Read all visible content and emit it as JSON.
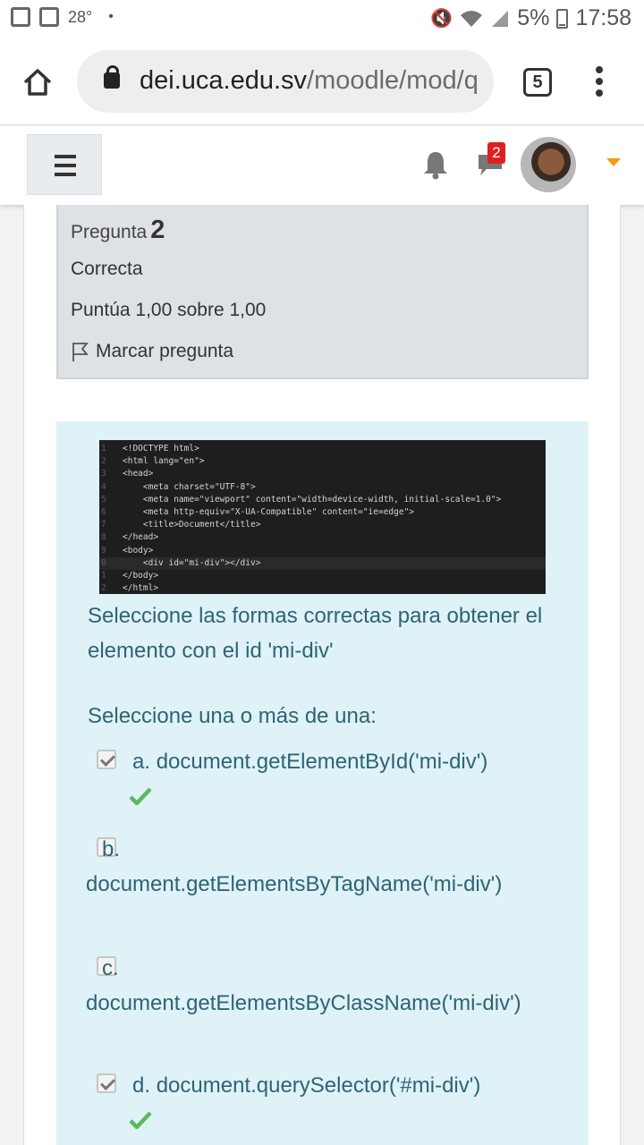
{
  "status_bar": {
    "temperature": "28°",
    "dot": "•",
    "battery": "5%",
    "time": "17:58"
  },
  "browser": {
    "url_domain": "dei.uca.edu.sv",
    "url_path": "/moodle/mod/q",
    "tab_count": "5"
  },
  "navbar": {
    "notification_badge": "2",
    "accent_color": "#f39c12"
  },
  "question_info": {
    "label": "Pregunta",
    "number": "2",
    "state": "Correcta",
    "grade": "Puntúa 1,00 sobre 1,00",
    "flag": "Marcar pregunta"
  },
  "code_snippet": {
    "lines": [
      {
        "no": "1",
        "text": "<!DOCTYPE html>"
      },
      {
        "no": "2",
        "text": "<html lang=\"en\">"
      },
      {
        "no": "3",
        "text": "<head>"
      },
      {
        "no": "4",
        "text": "    <meta charset=\"UTF-8\">"
      },
      {
        "no": "5",
        "text": "    <meta name=\"viewport\" content=\"width=device-width, initial-scale=1.0\">"
      },
      {
        "no": "6",
        "text": "    <meta http-equiv=\"X-UA-Compatible\" content=\"ie=edge\">"
      },
      {
        "no": "7",
        "text": "    <title>Document</title>"
      },
      {
        "no": "8",
        "text": "</head>"
      },
      {
        "no": "9",
        "text": "<body>"
      },
      {
        "no": "0",
        "text": "    <div id=\"mi-div\"></div>"
      },
      {
        "no": "1",
        "text": "</body>"
      },
      {
        "no": "2",
        "text": "</html>"
      }
    ]
  },
  "question": {
    "text": "Seleccione las formas correctas para obtener el elemento con el id 'mi-div'",
    "prompt": "Seleccione una o más de una:",
    "options": [
      {
        "letter": "a.",
        "text": "document.getElementById('mi-div')",
        "checked": true,
        "correct": true
      },
      {
        "letter": "b.",
        "text": "document.getElementsByTagName('mi-div')",
        "checked": false,
        "correct": false
      },
      {
        "letter": "c.",
        "text": "document.getElementsByClassName('mi-div')",
        "checked": false,
        "correct": false
      },
      {
        "letter": "d.",
        "text": "document.querySelector('#mi-div')",
        "checked": true,
        "correct": true
      }
    ]
  },
  "colors": {
    "correct_tick": "#5cb85c",
    "content_bg": "#def2f8",
    "text": "#2f6473"
  }
}
